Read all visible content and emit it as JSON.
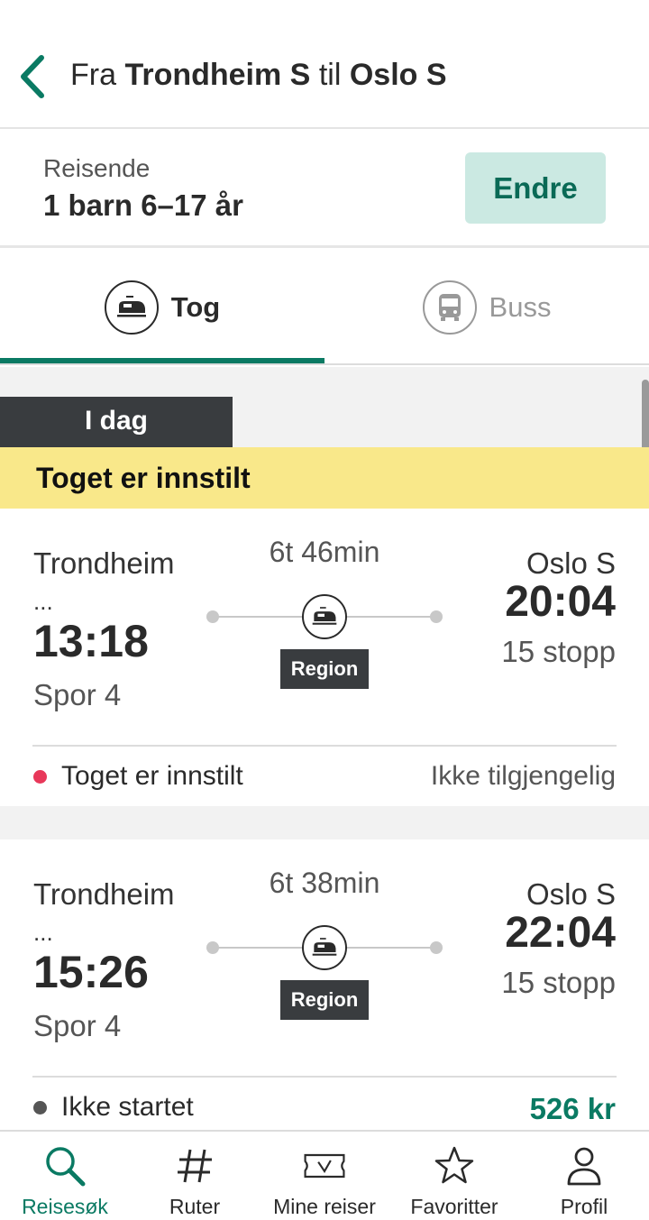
{
  "header": {
    "title_prefix": "Fra",
    "from": "Trondheim S",
    "title_mid": "til",
    "to": "Oslo S",
    "back_icon": "chevron-left-icon"
  },
  "travellers": {
    "label": "Reisende",
    "value": "1 barn 6–17 år",
    "change_button": "Endre"
  },
  "tabs": [
    {
      "label": "Tog",
      "icon": "train-icon",
      "selected": true
    },
    {
      "label": "Buss",
      "icon": "bus-icon",
      "selected": false
    }
  ],
  "results": {
    "day_label": "I dag",
    "alert": "Toget er innstilt",
    "trips": [
      {
        "from": "Trondheim",
        "from_suffix": "...",
        "departure": "13:18",
        "track": "Spor  4",
        "duration": "6t 46min",
        "product": "Region",
        "to": "Oslo S",
        "arrival": "20:04",
        "stops": "15 stopp",
        "status": "Toget er innstilt",
        "status_color": "#e8385a",
        "availability": "Ikke tilgjengelig"
      },
      {
        "from": "Trondheim",
        "from_suffix": "...",
        "departure": "15:26",
        "track": "Spor  4",
        "duration": "6t 38min",
        "product": "Region",
        "to": "Oslo S",
        "arrival": "22:04",
        "stops": "15 stopp",
        "status": "Ikke startet",
        "status_color": "#555555",
        "price": "526 kr"
      }
    ]
  },
  "nav": [
    {
      "label": "Reisesøk",
      "icon": "search-icon",
      "active": true
    },
    {
      "label": "Ruter",
      "icon": "hash-icon",
      "active": false
    },
    {
      "label": "Mine reiser",
      "icon": "ticket-icon",
      "active": false
    },
    {
      "label": "Favoritter",
      "icon": "star-icon",
      "active": false
    },
    {
      "label": "Profil",
      "icon": "person-icon",
      "active": false
    }
  ],
  "colors": {
    "accent": "#0a7a63",
    "alert_bg": "#f9e88a",
    "button_bg": "#cbe9e2"
  }
}
